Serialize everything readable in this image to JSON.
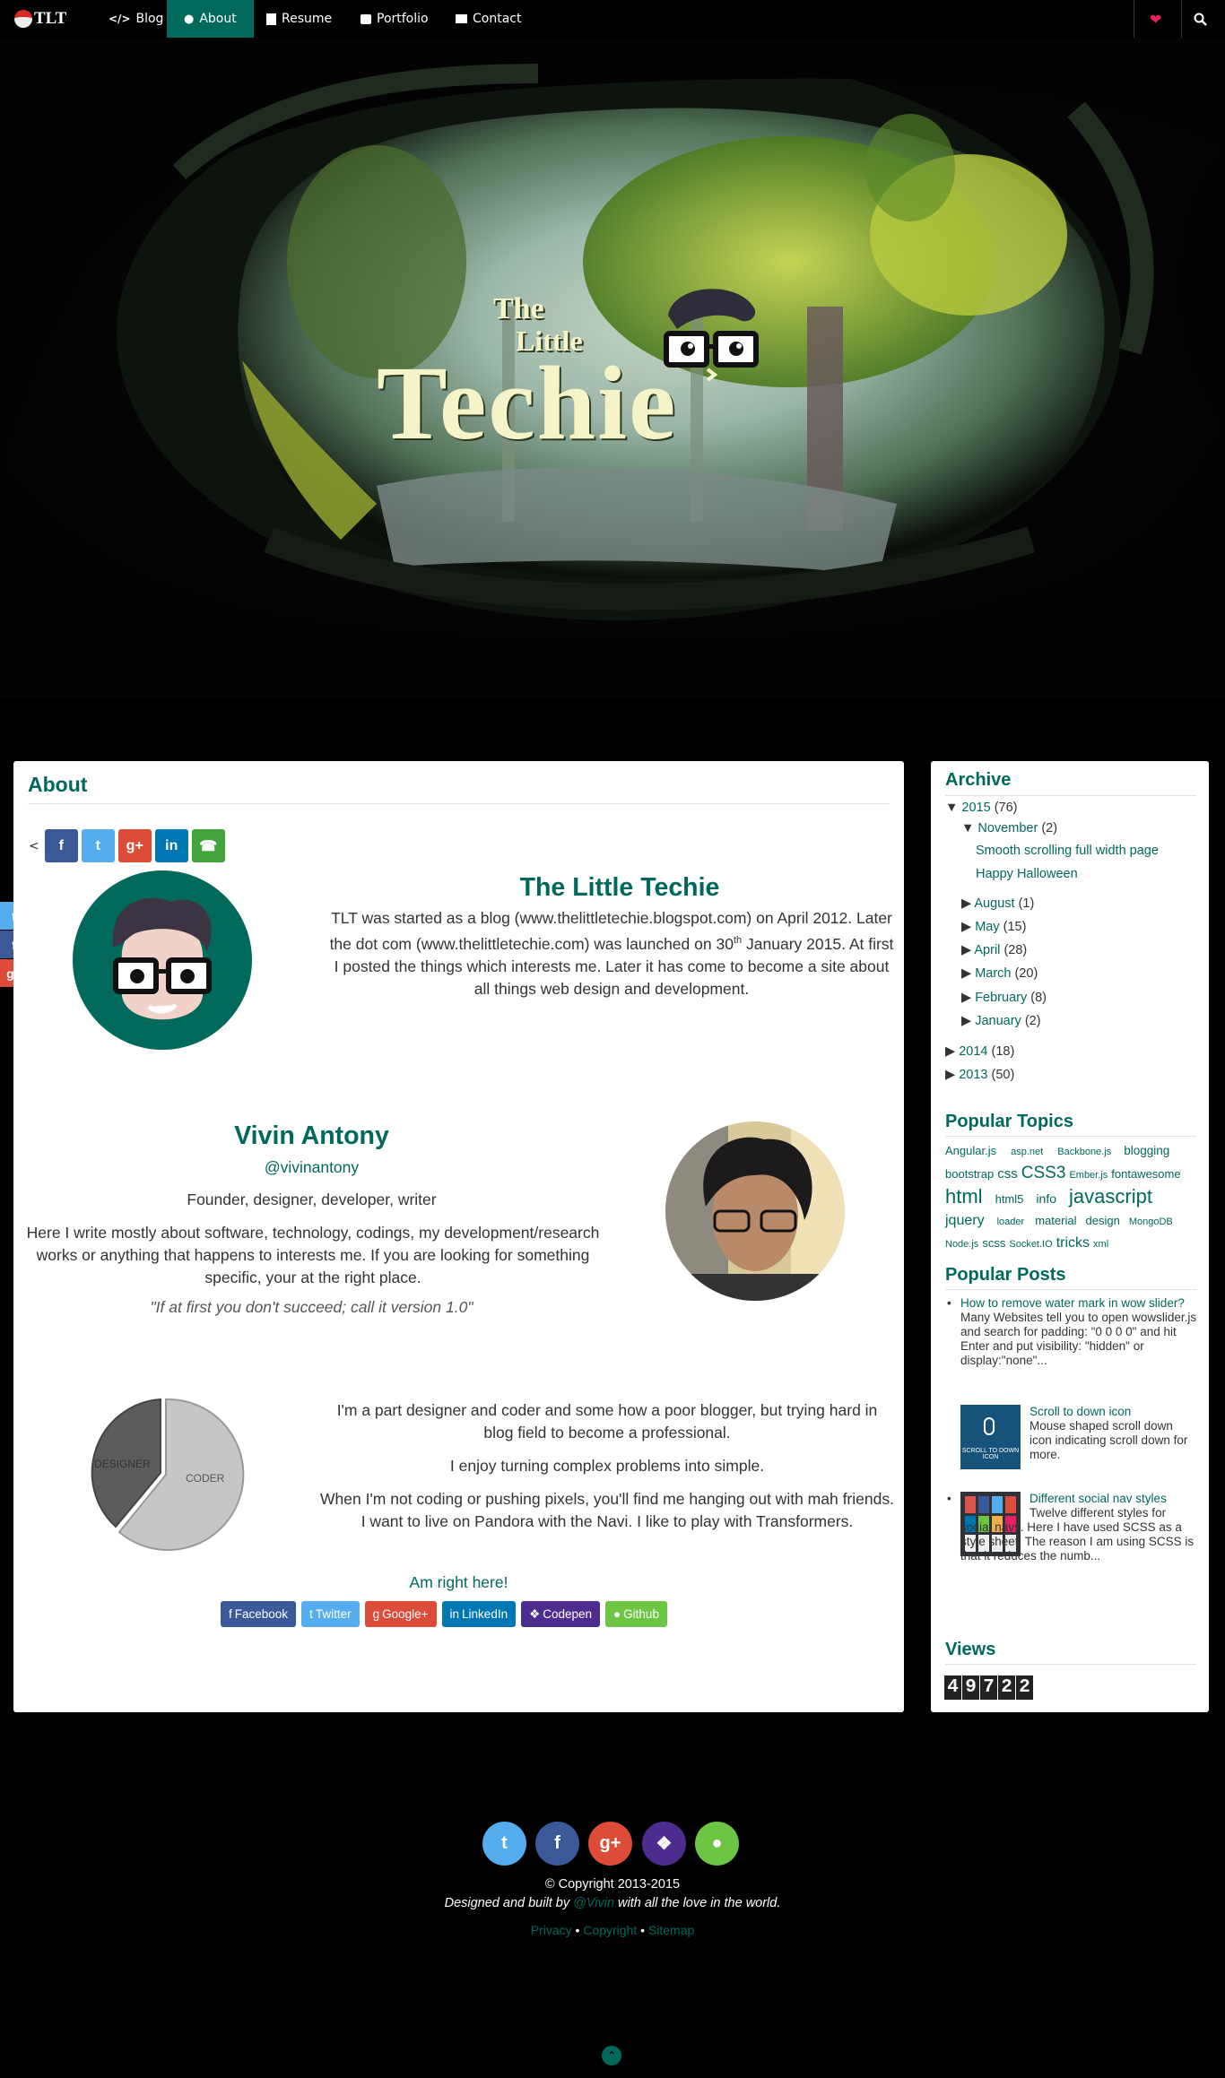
{
  "nav": {
    "brand": "TLT",
    "items": [
      {
        "icon": "code-icon",
        "label": "Blog"
      },
      {
        "icon": "user-icon",
        "label": "About"
      },
      {
        "icon": "file-icon",
        "label": "Resume"
      },
      {
        "icon": "briefcase-icon",
        "label": "Portfolio"
      },
      {
        "icon": "envelope-icon",
        "label": "Contact"
      }
    ],
    "active": "About",
    "right_icons": [
      "heart-icon",
      "search-icon"
    ]
  },
  "hero": {
    "logo_line1": "The",
    "logo_line2": "Little",
    "logo_line3": "Techie"
  },
  "about": {
    "title": "About",
    "share_buttons": [
      "facebook-icon",
      "twitter-icon",
      "google-plus-icon",
      "linkedin-icon",
      "whatsapp-icon"
    ],
    "site_title": "The Little Techie",
    "site_text_1": "TLT was started as a blog (www.thelittletechie.blogspot.com) on April 2012. Later the dot com (www.thelittletechie.com) was launched on",
    "site_text_day": "30",
    "site_text_sup": "th",
    "site_text_2": "January 2015. At first I posted the things which interests me. Later it has come to become a site about all things web design and development.",
    "name": "Vivin Antony",
    "handle": "@vivinantony",
    "role": "Founder, designer, developer, writer",
    "bio": "Here I write mostly about software, technology, codings, my development/research works or anything that happens to interests me. If you are looking for something specific, your at the right place.",
    "quote": "\"If at first you don't succeed; call it version 1.0\"",
    "pie_labels": [
      "DESIGNER",
      "CODER"
    ],
    "text_1": "I'm a part designer and coder and some how a poor blogger, but trying hard in blog field to become a professional.",
    "text_2": "I enjoy turning complex problems into simple.",
    "text_3": "When I'm not coding or pushing pixels, you'll find me hanging out with mah friends. I want to live on Pandora with the Navi. I like to play with Transformers.",
    "am_right_here": "Am right here!",
    "social_buttons": [
      {
        "label": "Facebook",
        "color": "#3b5998"
      },
      {
        "label": "Twitter",
        "color": "#55acee"
      },
      {
        "label": "Google+",
        "color": "#dd4b39"
      },
      {
        "label": "LinkedIn",
        "color": "#0077b5"
      },
      {
        "label": "Codepen",
        "color": "#4d2c8f"
      },
      {
        "label": "Github",
        "color": "#6cc644"
      }
    ]
  },
  "sidebar": {
    "archive_title": "Archive",
    "archive": {
      "y2015": "2015",
      "y2015_count": "(76)",
      "november": "November",
      "november_count": "(2)",
      "post1": "Smooth scrolling full width page",
      "post2": "Happy Halloween",
      "months": [
        {
          "name": "August",
          "count": "(1)"
        },
        {
          "name": "May",
          "count": "(15)"
        },
        {
          "name": "April",
          "count": "(28)"
        },
        {
          "name": "March",
          "count": "(20)"
        },
        {
          "name": "February",
          "count": "(8)"
        },
        {
          "name": "January",
          "count": "(2)"
        }
      ],
      "y2014": "2014",
      "y2014_count": "(18)",
      "y2013": "2013",
      "y2013_count": "(50)"
    },
    "topics_title": "Popular Topics",
    "topics": [
      "Angular.js",
      "asp.net",
      "Backbone.js",
      "blogging",
      "bootstrap",
      "css",
      "CSS3",
      "Ember.js",
      "fontawesome",
      "html",
      "html5",
      "info",
      "javascript",
      "jquery",
      "loader",
      "material",
      "design",
      "MongoDB",
      "Node.js",
      "scss",
      "Socket.IO",
      "tricks",
      "xml"
    ],
    "posts_title": "Popular Posts",
    "posts": [
      {
        "title": "How to remove water mark in wow slider?",
        "excerpt": "Many Websites tell you to open wowslider.js and search for padding: \"0 0 0 0\" and hit Enter and put visibility: \"hidden\" or display:\"none\"..."
      },
      {
        "title": "Scroll to down icon",
        "excerpt": "Mouse shaped scroll down icon indicating scroll down for more.",
        "thumb_text": "SCROLL TO DOWN ICON"
      },
      {
        "title": "Different social nav styles",
        "excerpt": "Twelve different styles for social navs. Here I have used SCSS as a style sheet. The reason I am using SCSS is that it reduces the numb..."
      }
    ],
    "views_title": "Views",
    "views_digits": [
      "4",
      "9",
      "7",
      "2",
      "2"
    ]
  },
  "footer": {
    "social": [
      "twitter-icon",
      "facebook-icon",
      "google-plus-icon",
      "codepen-icon",
      "github-icon"
    ],
    "copyright": "Copyright 2013-2015",
    "built_pre": "Designed and built by",
    "built_name": "@Vivin",
    "built_post": "with all the love in the world.",
    "links": [
      "Privacy",
      "Copyright",
      "Sitemap"
    ],
    "link_sep": "•"
  },
  "colors": {
    "accent": "#00695c",
    "nav_bg": "#000000"
  }
}
